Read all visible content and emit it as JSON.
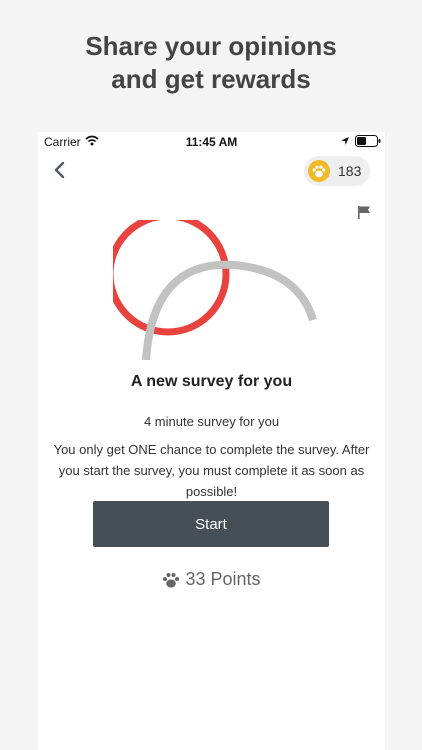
{
  "promo": {
    "headline_line1": "Share your opinions",
    "headline_line2": "and get rewards"
  },
  "status_bar": {
    "carrier": "Carrier",
    "time": "11:45 AM"
  },
  "nav": {
    "points_balance": "183"
  },
  "survey": {
    "title": "A new survey for you",
    "duration": "4 minute survey for you",
    "warning": "You only get ONE chance to complete the survey. After you start the survey, you must complete it as soon as possible!",
    "start_label": "Start",
    "reward": "33 Points"
  },
  "colors": {
    "accent_red": "#e8433e",
    "button_dark": "#464f55",
    "paw_yellow": "#f2b928"
  },
  "icons": [
    "wifi-icon",
    "location-icon",
    "battery-icon",
    "back-chevron-icon",
    "paw-icon",
    "flag-icon"
  ]
}
